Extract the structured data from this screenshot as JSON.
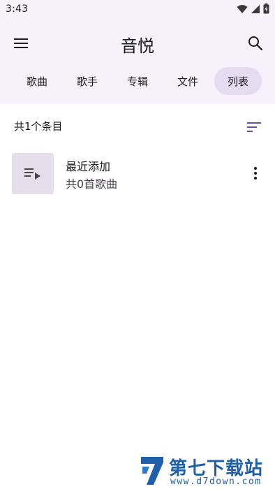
{
  "status_bar": {
    "time": "3:43",
    "icons": [
      "wifi-icon",
      "signal-icon",
      "battery-icon"
    ]
  },
  "app_bar": {
    "title": "音悦",
    "menu_icon": "menu-icon",
    "search_icon": "search-icon"
  },
  "tabs": [
    {
      "label": "歌曲",
      "active": false
    },
    {
      "label": "歌手",
      "active": false
    },
    {
      "label": "专辑",
      "active": false
    },
    {
      "label": "文件",
      "active": false
    },
    {
      "label": "列表",
      "active": true
    }
  ],
  "list_header": {
    "count_text": "共1个条目",
    "sort_icon": "sort-icon"
  },
  "playlists": [
    {
      "title": "最近添加",
      "subtitle": "共0首歌曲",
      "icon": "playlist-play-icon",
      "more_icon": "more-vert-icon"
    }
  ],
  "watermark": {
    "text": "第七下载站",
    "url": "www.d7down.com"
  },
  "colors": {
    "header_bg": "#f6f1fa",
    "active_tab_bg": "#e6dcf2",
    "thumb_bg": "#e6dfeb",
    "accent": "#6750a4",
    "watermark": "#1f5ea8"
  }
}
